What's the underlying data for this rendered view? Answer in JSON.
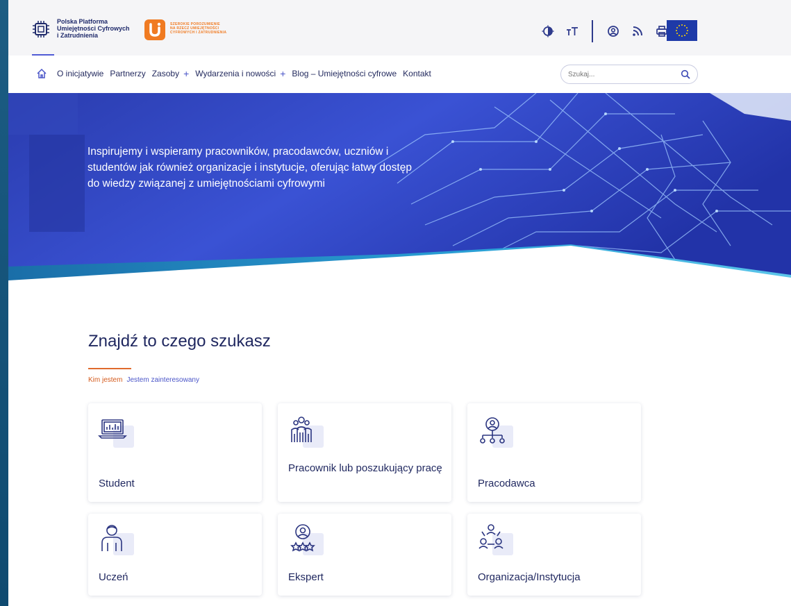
{
  "header": {
    "logo_primary_lines": [
      "Polska Platforma",
      "Umiejętności Cyfrowych",
      "i Zatrudnienia"
    ],
    "logo_secondary_lines": [
      "SZEROKIE POROZUMIENIE",
      "NA RZECZ UMIEJĘTNOŚCI",
      "CYFROWYCH I ZATRUDNIENIA"
    ],
    "icons": [
      "contrast-icon",
      "font-size-icon",
      "account-icon",
      "rss-icon",
      "print-icon"
    ],
    "eu_flag_color": "#1e3aa8"
  },
  "nav": {
    "items": [
      {
        "label": "O inicjatywie",
        "expandable": false
      },
      {
        "label": "Partnerzy",
        "expandable": false
      },
      {
        "label": "Zasoby",
        "expandable": true
      },
      {
        "label": "Wydarzenia i nowości",
        "expandable": true
      },
      {
        "label": "Blog – Umiejętności cyfrowe",
        "expandable": false
      },
      {
        "label": "Kontakt",
        "expandable": false
      }
    ],
    "expand_symbol": "+",
    "search_placeholder": "Szukaj..."
  },
  "hero": {
    "text": "Inspirujemy i wspieramy pracowników, pracodawców, uczniów i studentów jak również organizacje i instytucje, oferując łatwy dostęp do wiedzy związanej z umiejętnościami cyfrowymi"
  },
  "finder": {
    "title": "Znajdź to czego szukasz",
    "tabs": [
      {
        "label": "Kim jestem",
        "active": true
      },
      {
        "label": "Jestem zainteresowany",
        "active": false
      }
    ],
    "cards": [
      {
        "label": "Student",
        "icon": "laptop-icon"
      },
      {
        "label": "Pracownik lub poszukujący pracę",
        "icon": "workers-group-icon"
      },
      {
        "label": "Pracodawca",
        "icon": "employer-hierarchy-icon"
      },
      {
        "label": "Uczeń",
        "icon": "pupil-icon"
      },
      {
        "label": "Ekspert",
        "icon": "expert-stars-icon"
      },
      {
        "label": "Organizacja/Instytucja",
        "icon": "organization-icon"
      }
    ]
  },
  "colors": {
    "accent": "#4a55c8",
    "brand_dark": "#1f275f",
    "active_tab": "#d45a1c",
    "hero_blue": "#3046c4"
  }
}
